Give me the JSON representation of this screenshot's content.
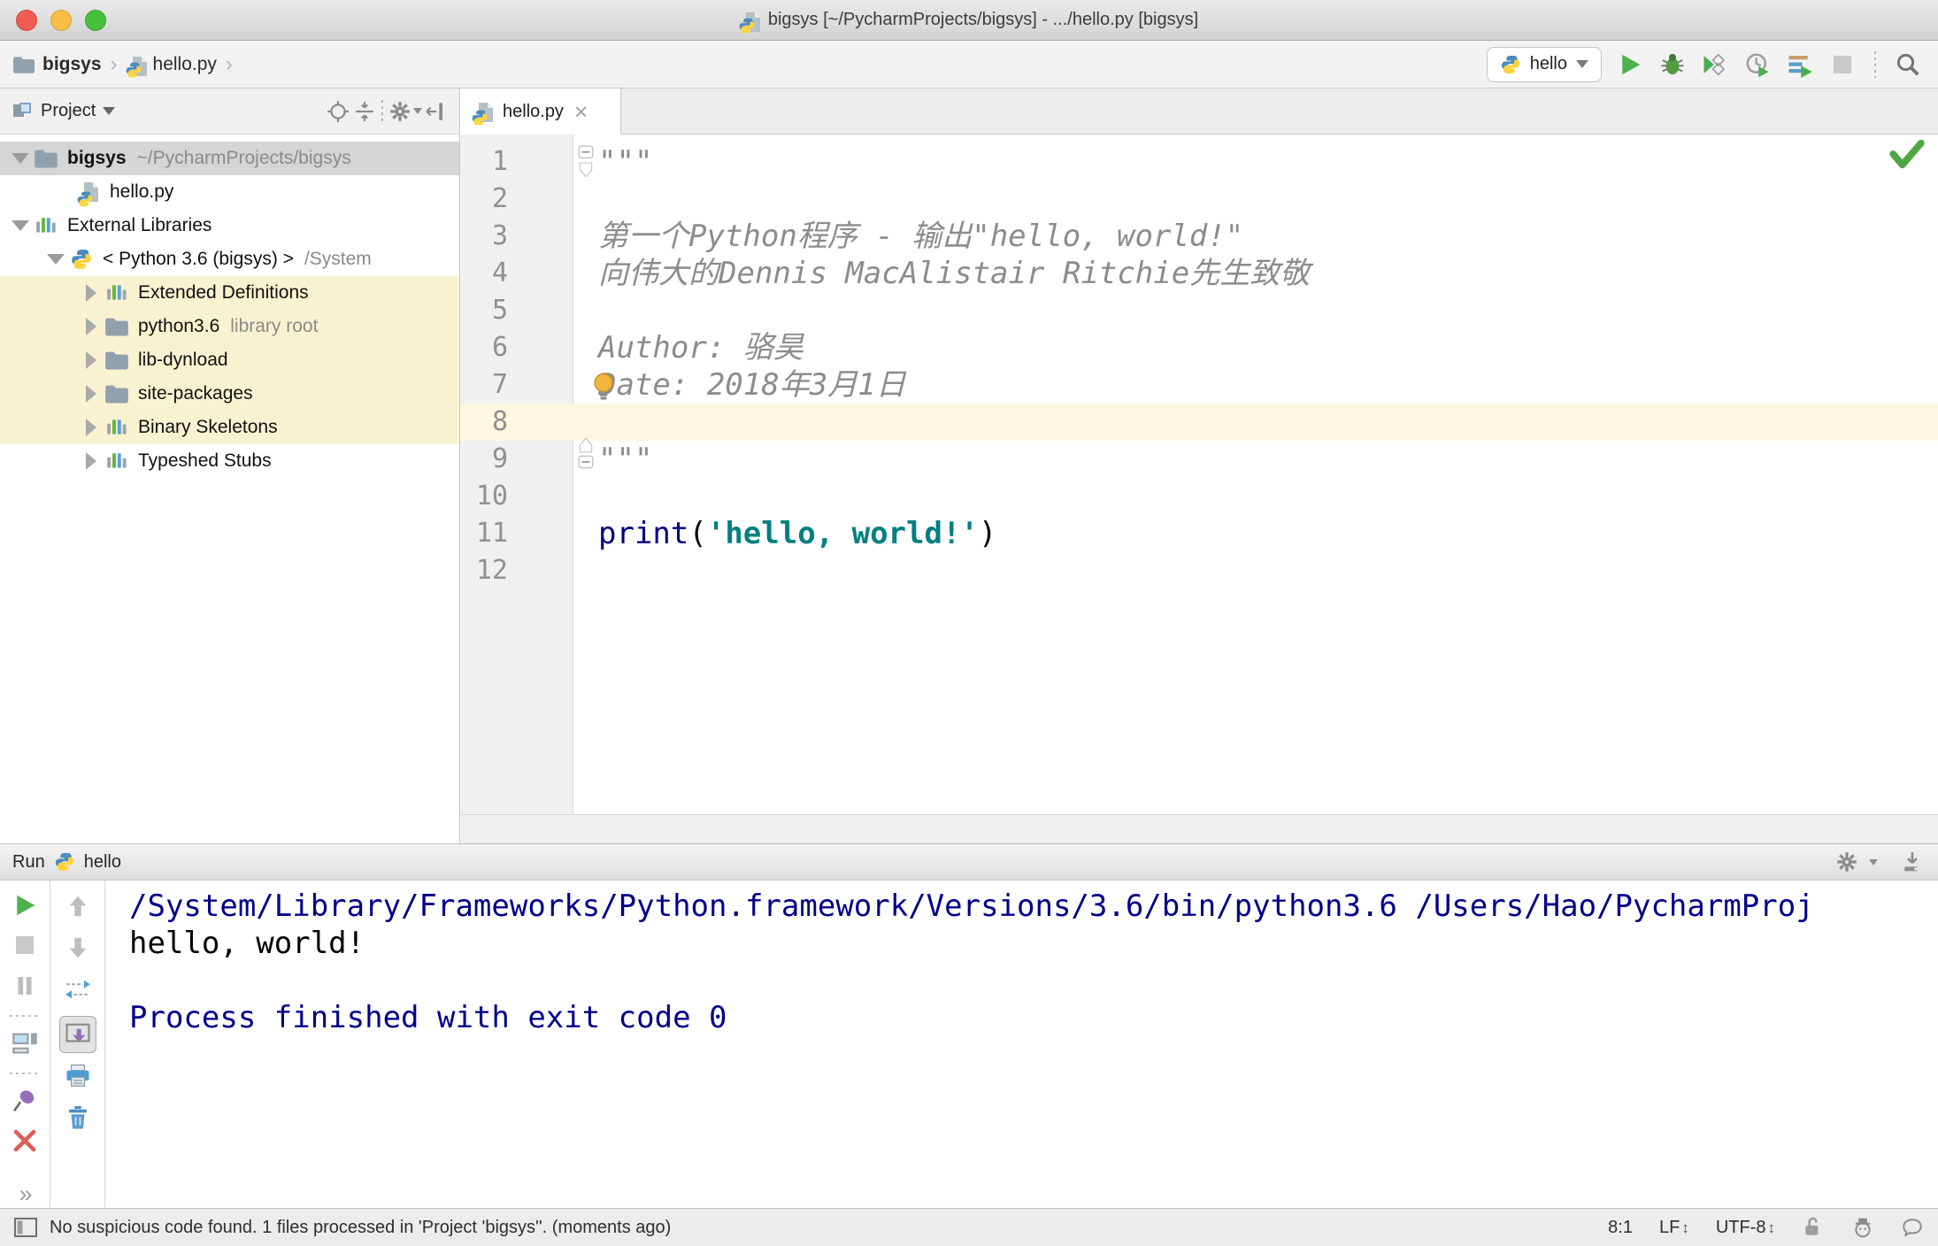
{
  "title_bar": {
    "title": "bigsys [~/PycharmProjects/bigsys] - .../hello.py [bigsys]"
  },
  "nav_bar": {
    "breadcrumb_project": "bigsys",
    "breadcrumb_file": "hello.py",
    "run_config_label": "hello"
  },
  "project_panel": {
    "title": "Project",
    "tree": [
      {
        "label": "bigsys",
        "suffix": "~/PycharmProjects/bigsys"
      },
      {
        "label": "hello.py"
      },
      {
        "label": "External Libraries"
      },
      {
        "label": "< Python 3.6 (bigsys) >",
        "suffix": "/System"
      },
      {
        "label": "Extended Definitions"
      },
      {
        "label": "python3.6",
        "suffix": "library root"
      },
      {
        "label": "lib-dynload"
      },
      {
        "label": "site-packages"
      },
      {
        "label": "Binary Skeletons"
      },
      {
        "label": "Typeshed Stubs"
      }
    ]
  },
  "editor": {
    "tab_label": "hello.py",
    "line_numbers": [
      "1",
      "2",
      "3",
      "4",
      "5",
      "6",
      "7",
      "8",
      "9",
      "10",
      "11",
      "12"
    ],
    "code": {
      "docstring_delim": "\"\"\"",
      "line3": "第一个Python程序 - 输出\"hello, world!\"",
      "line4": "向伟大的Dennis MacAlistair Ritchie先生致敬",
      "line6": "Author: 骆昊",
      "line7": "Date: 2018年3月1日",
      "line11_kw": "print",
      "line11_open": "(",
      "line11_str": "'hello, world!'",
      "line11_close": ")"
    }
  },
  "run_panel": {
    "title": "Run",
    "config": "hello",
    "console_line1": "/System/Library/Frameworks/Python.framework/Versions/3.6/bin/python3.6 /Users/Hao/PycharmProj",
    "console_line2": "hello, world!",
    "console_line4": "Process finished with exit code 0"
  },
  "status_bar": {
    "message": "No suspicious code found. 1 files processed in 'Project 'bigsys''. (moments ago)",
    "caret_position": "8:1",
    "line_separator": "LF",
    "encoding": "UTF-8"
  },
  "icons": {
    "breadcrumb_chevron": "›",
    "tab_close": "×",
    "more_chevrons": "»",
    "updown_arrow": "↕"
  },
  "colors": {
    "selection_bg": "#d5d5d5",
    "library_highlight_bg": "#f8f2d0",
    "caret_line_bg": "#fdf7e0",
    "keyword": "#000080",
    "string": "#008080",
    "docstring": "#8c8c8c",
    "console_system": "#00008b",
    "run_green": "#4caf50"
  }
}
